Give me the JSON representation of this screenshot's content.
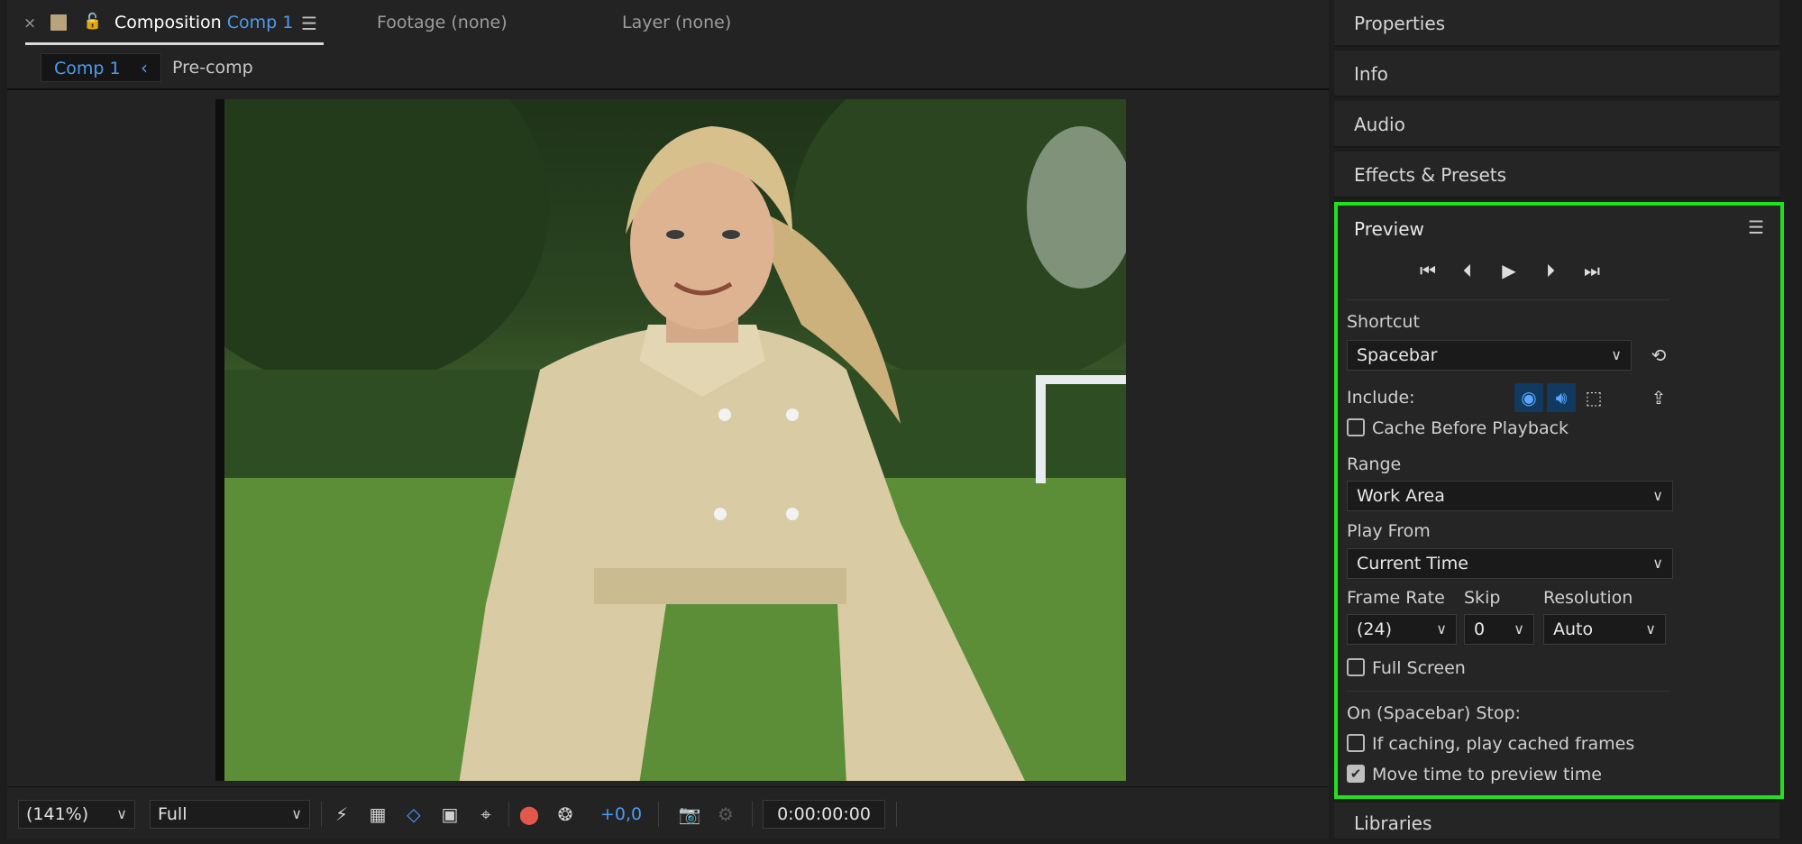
{
  "comp_panel": {
    "tabs": {
      "close_glyph": "×",
      "composition_prefix": "Composition",
      "composition_name": "Comp 1",
      "footage": "Footage (none)",
      "layer": "Layer (none)"
    },
    "breadcrumbs": {
      "active": "Comp 1",
      "other": "Pre-comp"
    },
    "toolbar": {
      "zoom": "(141%)",
      "resolution": "Full",
      "exposure": "+0,0",
      "timecode": "0:00:00:00"
    }
  },
  "right_panels": {
    "collapsed": [
      "Properties",
      "Info",
      "Audio",
      "Effects & Presets"
    ],
    "libraries": "Libraries"
  },
  "preview": {
    "title": "Preview",
    "shortcut_label": "Shortcut",
    "shortcut_value": "Spacebar",
    "include_label": "Include:",
    "cache_before_playback": {
      "label": "Cache Before Playback",
      "checked": false
    },
    "range_label": "Range",
    "range_value": "Work Area",
    "play_from_label": "Play From",
    "play_from_value": "Current Time",
    "frame_rate_label": "Frame Rate",
    "frame_rate_value": "(24)",
    "skip_label": "Skip",
    "skip_value": "0",
    "resolution_label": "Resolution",
    "resolution_value": "Auto",
    "full_screen": {
      "label": "Full Screen",
      "checked": false
    },
    "on_stop_label": "On (Spacebar) Stop:",
    "if_caching": {
      "label": "If caching, play cached frames",
      "checked": false
    },
    "move_time": {
      "label": "Move time to preview time",
      "checked": true
    }
  },
  "colors": {
    "accent_blue": "#4e9bf0",
    "highlight_green": "#22e01c"
  }
}
